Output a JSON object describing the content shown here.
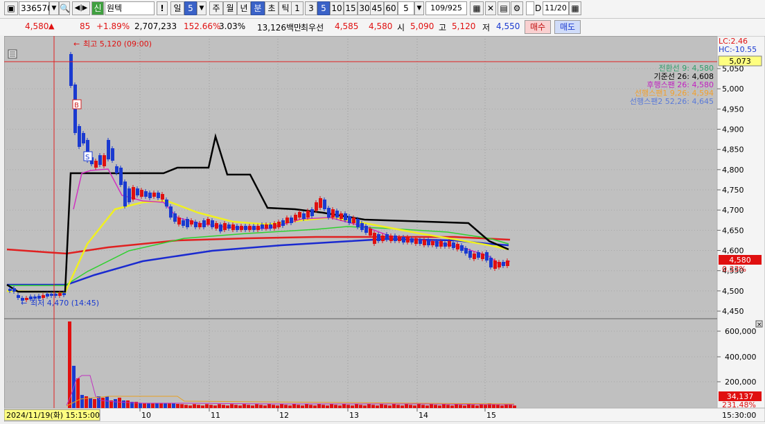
{
  "toolbar": {
    "code": "336570",
    "type_badge": "신",
    "name": "원텍",
    "period_buttons": [
      "일",
      "5",
      "주",
      "월",
      "년",
      "분",
      "초",
      "틱"
    ],
    "interval_buttons": [
      "1",
      "3",
      "5",
      "10",
      "15",
      "30",
      "45",
      "60"
    ],
    "interval_select": "5",
    "range": "109/925",
    "d_label": "D",
    "date": "11/20"
  },
  "quote": {
    "price": "4,580",
    "arrow": "▲",
    "change": "85",
    "change_pct": "+1.89%",
    "volume": "2,707,233",
    "vol_ratio": "152.66%",
    "turnover_rate": "3.03%",
    "amount": "13,126백만",
    "best_label": "최우선",
    "best_ask": "4,585",
    "best_bid": "4,580",
    "open_label": "시",
    "open": "5,090",
    "high_label": "고",
    "high": "5,120",
    "low_label": "저",
    "low": "4,550",
    "buy_label": "매수",
    "sell_label": "매도"
  },
  "chart": {
    "lc": "LC:2.46",
    "hc": "HC:-10.55",
    "cursor_price": "5,073",
    "high_marker": "최고 5,120 (09:00)",
    "low_marker": "최저 4,470 (14:45)",
    "legend": [
      {
        "text": "전환선 9: 4,580",
        "color": "#2f9e6a"
      },
      {
        "text": "기준선 26: 4,608",
        "color": "#000000"
      },
      {
        "text": "후행스팬 26: 4,580",
        "color": "#c020c0"
      },
      {
        "text": "선행스팬1 9,26: 4,594",
        "color": "#f0a030"
      },
      {
        "text": "선행스팬2 52,26: 4,645",
        "color": "#5a7ad8"
      }
    ],
    "price_ticks": [
      "5,050",
      "5,000",
      "4,950",
      "4,900",
      "4,850",
      "4,800",
      "4,750",
      "4,700",
      "4,650",
      "4,600",
      "4,550",
      "4,500",
      "4,450"
    ],
    "current_price_box": "4,580",
    "current_pct": "0.33%",
    "volume_ticks": [
      "600,000",
      "400,000",
      "200,000"
    ],
    "volume_box": "34,137",
    "volume_pct": "231.48%",
    "x_labels": [
      "10",
      "11",
      "12",
      "13",
      "14",
      "15"
    ],
    "date_box": "2024/11/19(화) 15:15:00",
    "time_label": "15:30:00",
    "marker_b": "B",
    "marker_s": "S",
    "colors": {
      "up": "#e01010",
      "down": "#1a3ad0",
      "bg": "#c0c0c0"
    }
  }
}
